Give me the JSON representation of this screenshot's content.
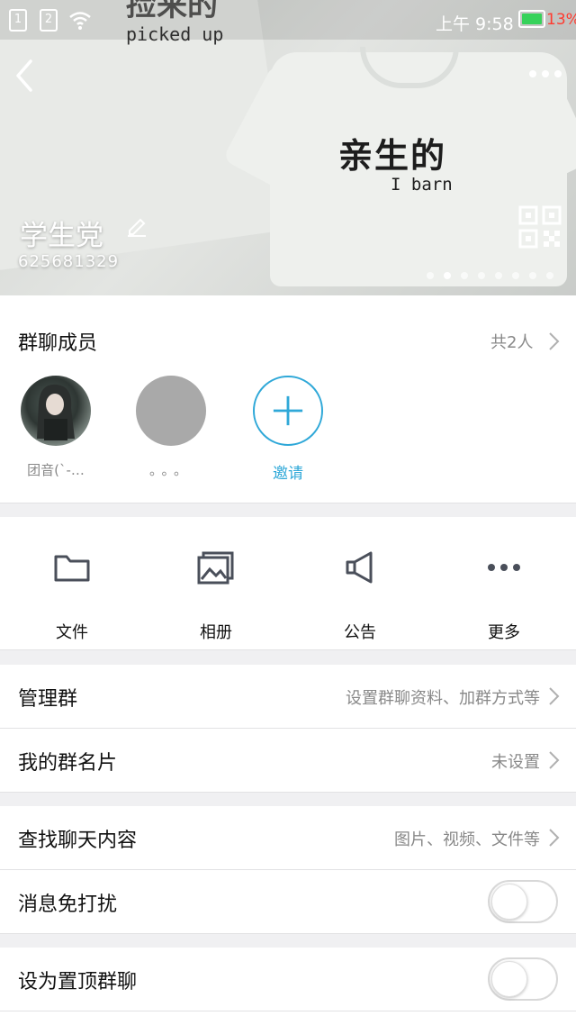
{
  "status_bar": {
    "sim1": "1",
    "sim2": "2",
    "time": "上午 9:58",
    "battery": "13%"
  },
  "header": {
    "shirt_top_cn": "捡来的",
    "shirt_top_en": "picked up",
    "shirt_cn": "亲生的",
    "shirt_en": "I barn",
    "group_name": "学生党",
    "group_id": "625681329"
  },
  "members": {
    "title": "群聊成员",
    "count": "共2人",
    "list": [
      {
        "name": "团音(`-…"
      },
      {
        "name": "。。。"
      }
    ],
    "invite_label": "邀请"
  },
  "tools": [
    {
      "label": "文件",
      "icon": "folder-icon"
    },
    {
      "label": "相册",
      "icon": "album-icon"
    },
    {
      "label": "公告",
      "icon": "megaphone-icon"
    },
    {
      "label": "更多",
      "icon": "more-icon"
    }
  ],
  "settings": {
    "manage": {
      "label": "管理群",
      "value": "设置群聊资料、加群方式等"
    },
    "card": {
      "label": "我的群名片",
      "value": "未设置"
    },
    "search": {
      "label": "查找聊天内容",
      "value": "图片、视频、文件等"
    },
    "mute": {
      "label": "消息免打扰"
    },
    "pin": {
      "label": "设为置顶群聊"
    }
  },
  "colors": {
    "accent": "#2fa8d8",
    "battery": "#36d25a",
    "battery_text": "#ff3b30"
  }
}
